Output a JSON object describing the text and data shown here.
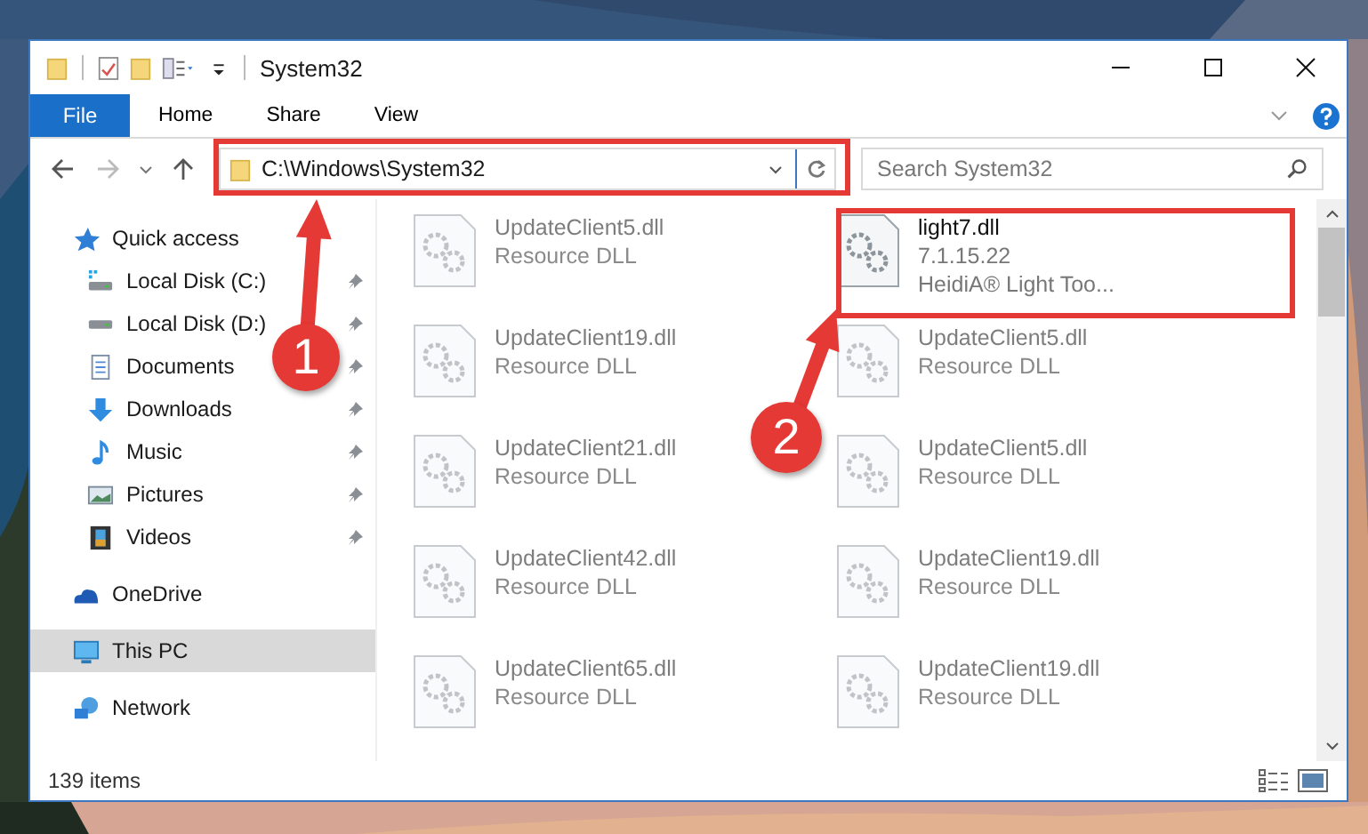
{
  "window": {
    "title": "System32"
  },
  "ribbon": {
    "tabs": [
      {
        "label": "File",
        "kind": "file"
      },
      {
        "label": "Home",
        "kind": "tab"
      },
      {
        "label": "Share",
        "kind": "tab"
      },
      {
        "label": "View",
        "kind": "tab"
      }
    ]
  },
  "address": {
    "path": "C:\\Windows\\System32"
  },
  "search": {
    "placeholder": "Search System32"
  },
  "sidebar": {
    "items": [
      {
        "label": "Quick access",
        "selected": false,
        "children": [
          {
            "label": "Local Disk (C:)",
            "selected": false,
            "pinned": true
          },
          {
            "label": "Local Disk (D:)",
            "selected": false,
            "pinned": true
          },
          {
            "label": "Documents",
            "selected": false,
            "pinned": true
          },
          {
            "label": "Downloads",
            "selected": false,
            "pinned": true
          },
          {
            "label": "Music",
            "selected": false,
            "pinned": true
          },
          {
            "label": "Pictures",
            "selected": false,
            "pinned": true
          },
          {
            "label": "Videos",
            "selected": false,
            "pinned": true
          }
        ]
      },
      {
        "label": "OneDrive",
        "selected": false
      },
      {
        "label": "This PC",
        "selected": true
      },
      {
        "label": "Network",
        "selected": false
      }
    ]
  },
  "files": [
    {
      "name": "UpdateClient5.dll",
      "details": [
        "Resource DLL"
      ],
      "blurred": true
    },
    {
      "name": "light7.dll",
      "details": [
        "7.1.15.22",
        "HeidiA® Light Too..."
      ],
      "blurred": false
    },
    {
      "name": "UpdateClient19.dll",
      "details": [
        "Resource DLL"
      ],
      "blurred": true
    },
    {
      "name": "UpdateClient5.dll",
      "details": [
        "Resource DLL"
      ],
      "blurred": true
    },
    {
      "name": "UpdateClient21.dll",
      "details": [
        "Resource DLL"
      ],
      "blurred": true
    },
    {
      "name": "UpdateClient5.dll",
      "details": [
        "Resource DLL"
      ],
      "blurred": true
    },
    {
      "name": "UpdateClient42.dll",
      "details": [
        "Resource DLL"
      ],
      "blurred": true
    },
    {
      "name": "UpdateClient19.dll",
      "details": [
        "Resource DLL"
      ],
      "blurred": true
    },
    {
      "name": "UpdateClient65.dll",
      "details": [
        "Resource DLL"
      ],
      "blurred": true
    },
    {
      "name": "UpdateClient19.dll",
      "details": [
        "Resource DLL"
      ],
      "blurred": true
    }
  ],
  "status_bar": {
    "text": "139 items"
  },
  "annotations": [
    {
      "label": "1"
    },
    {
      "label": "2"
    }
  ]
}
